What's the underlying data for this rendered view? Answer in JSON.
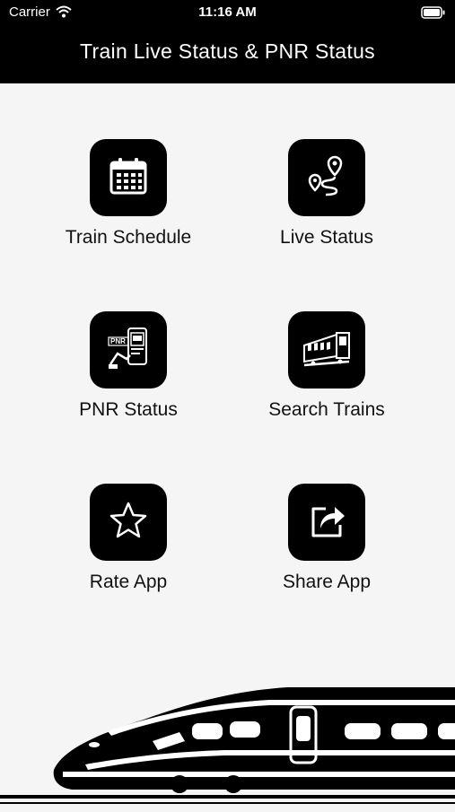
{
  "status_bar": {
    "carrier": "Carrier",
    "time": "11:16 AM"
  },
  "header": {
    "title": "Train Live Status & PNR Status"
  },
  "menu": {
    "items": [
      {
        "label": "Train Schedule",
        "icon": "calendar-icon"
      },
      {
        "label": "Live Status",
        "icon": "route-pin-icon"
      },
      {
        "label": "PNR Status",
        "icon": "pnr-ticket-icon",
        "icon_text": "PNR"
      },
      {
        "label": "Search Trains",
        "icon": "train-carriage-icon"
      },
      {
        "label": "Rate App",
        "icon": "star-icon"
      },
      {
        "label": "Share App",
        "icon": "share-icon"
      }
    ]
  },
  "colors": {
    "header_bg": "#000000",
    "page_bg": "#f5f5f5",
    "tile_bg": "#000000",
    "icon_fg": "#ffffff"
  }
}
